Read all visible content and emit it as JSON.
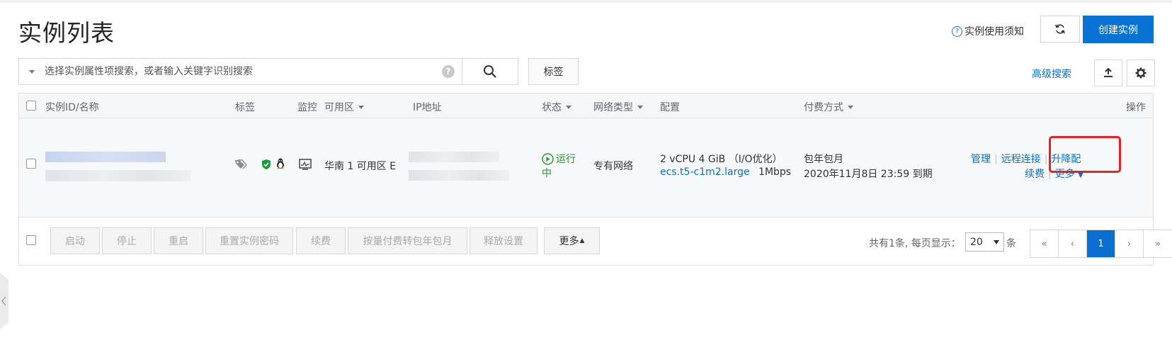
{
  "page": {
    "title": "实例列表"
  },
  "header": {
    "notice_label": "实例使用须知",
    "create_label": "创建实例"
  },
  "search": {
    "placeholder": "选择实例属性项搜索，或者输入关键字识别搜索",
    "tag_button": "标签",
    "advanced_label": "高级搜索"
  },
  "table": {
    "columns": {
      "id_name": "实例ID/名称",
      "tags": "标签",
      "monitor": "监控",
      "zone": "可用区",
      "ip": "IP地址",
      "status": "状态",
      "network": "网络类型",
      "config": "配置",
      "billing": "付费方式",
      "actions": "操作"
    },
    "rows": [
      {
        "zone": "华南 1 可用区 E",
        "status_line1": "运行",
        "status_line2": "中",
        "network": "专有网络",
        "config_line1": "2 vCPU 4 GiB （I/O优化）",
        "instance_type": "ecs.t5-c1m2.large",
        "bandwidth": "1Mbps",
        "billing_type": "包年包月",
        "expiry": "2020年11月8日 23:59 到期",
        "actions": {
          "manage": "管理",
          "remote": "远程连接",
          "upgrade": "升降配",
          "renew": "续费",
          "more": "更多"
        }
      }
    ]
  },
  "footer": {
    "buttons": [
      "启动",
      "停止",
      "重启",
      "重置实例密码",
      "续费",
      "按量付费转包年包月",
      "释放设置"
    ],
    "more_label": "更多",
    "page_info": "共有1条, 每页显示：",
    "page_size": "20",
    "page_unit": "条",
    "pager": {
      "first": "«",
      "prev": "‹",
      "current": "1",
      "next": "›",
      "last": "»"
    }
  },
  "colors": {
    "accent": "#0a6fd1",
    "running": "#1f9e2e",
    "highlight": "#e62222"
  }
}
